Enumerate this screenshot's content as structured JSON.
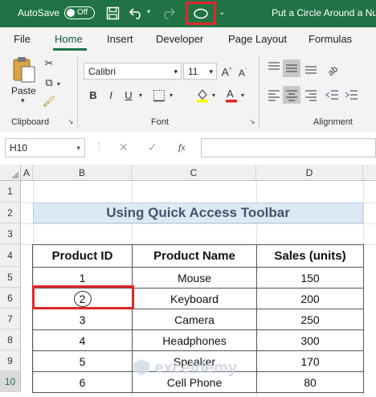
{
  "titlebar": {
    "autosave_label": "AutoSave",
    "autosave_state": "Off",
    "doc_title": "Put a Circle Around a Nu"
  },
  "ribbon_tabs": [
    "File",
    "Home",
    "Insert",
    "Developer",
    "Page Layout",
    "Formulas"
  ],
  "active_tab": "Home",
  "clipboard": {
    "paste_label": "Paste",
    "group_label": "Clipboard"
  },
  "font": {
    "name": "Calibri",
    "size": "11",
    "group_label": "Font",
    "bold": "B",
    "italic": "I",
    "underline": "U"
  },
  "alignment": {
    "group_label": "Alignment"
  },
  "formula_bar": {
    "name_box": "H10",
    "fx": "fx"
  },
  "columns": [
    "A",
    "B",
    "C",
    "D"
  ],
  "rows": [
    "1",
    "2",
    "3",
    "4",
    "5",
    "6",
    "7",
    "8",
    "9",
    "10"
  ],
  "sheet": {
    "banner": "Using Quick Access Toolbar",
    "headers": [
      "Product ID",
      "Product Name",
      "Sales (units)"
    ],
    "records": [
      [
        "1",
        "Mouse",
        "150"
      ],
      [
        "2",
        "Keyboard",
        "200"
      ],
      [
        "3",
        "Camera",
        "250"
      ],
      [
        "4",
        "Headphones",
        "300"
      ],
      [
        "5",
        "Speaker",
        "170"
      ],
      [
        "6",
        "Cell Phone",
        "80"
      ]
    ]
  },
  "watermark": "exceldemy",
  "colors": {
    "excel_green": "#217346",
    "highlight_red": "#e3262b",
    "banner_fill": "#dce9f5"
  }
}
